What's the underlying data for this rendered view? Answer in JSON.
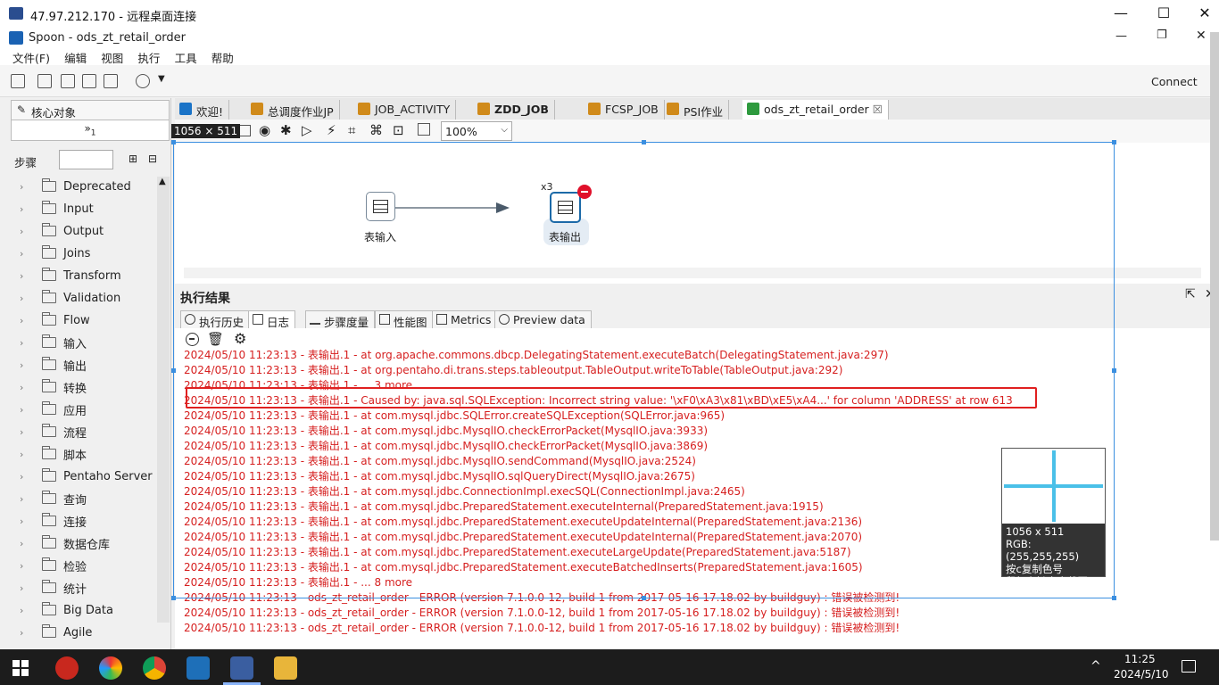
{
  "window": {
    "title": "47.97.212.170 - 远程桌面连接",
    "minimize": "—",
    "maximize": "☐",
    "close": "✕"
  },
  "app": {
    "title": "Spoon - ods_zt_retail_order",
    "restore": "❐",
    "minimize2": "—",
    "close2": "✕"
  },
  "menu": [
    "文件(F)",
    "编辑",
    "视图",
    "执行",
    "工具",
    "帮助"
  ],
  "connect": "Connect",
  "left_panel": {
    "tab_core": "核心对象",
    "collapse": "»",
    "collapse_sub": "1",
    "steps_label": "步骤",
    "tree": [
      "Deprecated",
      "Input",
      "Output",
      "Joins",
      "Transform",
      "Validation",
      "Flow",
      "输入",
      "输出",
      "转换",
      "应用",
      "流程",
      "脚本",
      "Pentaho Server",
      "查询",
      "连接",
      "数据仓库",
      "检验",
      "统计",
      "Big Data",
      "Agile"
    ]
  },
  "tabs": [
    {
      "label": "欢迎!",
      "color": "#1a73c7",
      "bold": false
    },
    {
      "label": "总调度作业JP",
      "color": "#d08a1a",
      "bold": false
    },
    {
      "label": "JOB_ACTIVITY",
      "color": "#d08a1a",
      "bold": false
    },
    {
      "label": "ZDD_JOB",
      "color": "#d08a1a",
      "bold": true
    },
    {
      "label": "FCSP_JOB",
      "color": "#d08a1a",
      "bold": false
    },
    {
      "label": "PSI作业",
      "color": "#d08a1a",
      "bold": false
    },
    {
      "label": "ods_zt_retail_order",
      "color": "#2e9a3e",
      "bold": false
    }
  ],
  "tab_close": "☒",
  "size_tip": "1056 × 511",
  "zoom": "100%",
  "canvas": {
    "step1_label": "表输入",
    "step2_label": "表输出",
    "copies": "x3"
  },
  "results": {
    "title": "执行结果",
    "tabs": [
      "执行历史",
      "日志",
      "步骤度量",
      "性能图",
      "Metrics",
      "Preview data"
    ]
  },
  "log_lines": [
    "2024/05/10 11:23:13 - 表输出.1 -  at org.apache.commons.dbcp.DelegatingStatement.executeBatch(DelegatingStatement.java:297)",
    "2024/05/10 11:23:13 - 表输出.1 -  at org.pentaho.di.trans.steps.tableoutput.TableOutput.writeToTable(TableOutput.java:292)",
    "2024/05/10 11:23:13 - 表输出.1 -  ... 3 more",
    "2024/05/10 11:23:13 - 表输出.1 - Caused by: java.sql.SQLException: Incorrect string value: '\\xF0\\xA3\\x81\\xBD\\xE5\\xA4...' for column 'ADDRESS' at row 613",
    "2024/05/10 11:23:13 - 表输出.1 -  at com.mysql.jdbc.SQLError.createSQLException(SQLError.java:965)",
    "2024/05/10 11:23:13 - 表输出.1 -  at com.mysql.jdbc.MysqlIO.checkErrorPacket(MysqlIO.java:3933)",
    "2024/05/10 11:23:13 - 表输出.1 -  at com.mysql.jdbc.MysqlIO.checkErrorPacket(MysqlIO.java:3869)",
    "2024/05/10 11:23:13 - 表输出.1 -  at com.mysql.jdbc.MysqlIO.sendCommand(MysqlIO.java:2524)",
    "2024/05/10 11:23:13 - 表输出.1 -  at com.mysql.jdbc.MysqlIO.sqlQueryDirect(MysqlIO.java:2675)",
    "2024/05/10 11:23:13 - 表输出.1 -  at com.mysql.jdbc.ConnectionImpl.execSQL(ConnectionImpl.java:2465)",
    "2024/05/10 11:23:13 - 表输出.1 -  at com.mysql.jdbc.PreparedStatement.executeInternal(PreparedStatement.java:1915)",
    "2024/05/10 11:23:13 - 表输出.1 -  at com.mysql.jdbc.PreparedStatement.executeUpdateInternal(PreparedStatement.java:2136)",
    "2024/05/10 11:23:13 - 表输出.1 -  at com.mysql.jdbc.PreparedStatement.executeUpdateInternal(PreparedStatement.java:2070)",
    "2024/05/10 11:23:13 - 表输出.1 -  at com.mysql.jdbc.PreparedStatement.executeLargeUpdate(PreparedStatement.java:5187)",
    "2024/05/10 11:23:13 - 表输出.1 -  at com.mysql.jdbc.PreparedStatement.executeBatchedInserts(PreparedStatement.java:1605)",
    "2024/05/10 11:23:13 - 表输出.1 -  ... 8 more",
    "2024/05/10 11:23:13 - ods_zt_retail_order - ERROR (version 7.1.0.0-12, build 1 from 2017-05-16 17.18.02 by buildguy) : 错误被检测到!",
    "2024/05/10 11:23:13 - ods_zt_retail_order - ERROR (version 7.1.0.0-12, build 1 from 2017-05-16 17.18.02 by buildguy) : 错误被检测到!",
    "2024/05/10 11:23:13 - ods_zt_retail_order - ERROR (version 7.1.0.0-12, build 1 from 2017-05-16 17.18.02 by buildguy) : 错误被检测到!"
  ],
  "magnifier": {
    "size": "1056 x 511",
    "rgb": "RGB:(255,255,255)",
    "hint1": "按c复制色号",
    "hint2": "鼠标右键自由截图"
  },
  "taskbar": {
    "time": "11:25",
    "date": "2024/5/10",
    "chevron": "^"
  }
}
